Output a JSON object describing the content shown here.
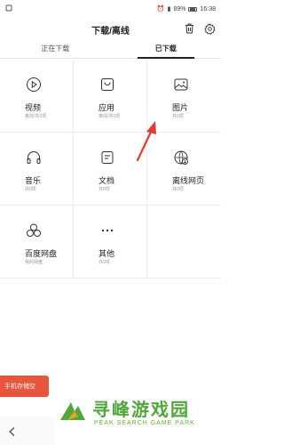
{
  "status_bar": {
    "left_icons": "notification-icon",
    "time": "16:38",
    "battery": "89%"
  },
  "header": {
    "title": "下载/离线"
  },
  "tabs": [
    {
      "label": "正在下载",
      "active": false
    },
    {
      "label": "已下载",
      "active": true
    }
  ],
  "categories": [
    {
      "title": "视频",
      "subtitle": "离线/共0项",
      "icon": "play-icon"
    },
    {
      "title": "应用",
      "subtitle": "离线/共0项",
      "icon": "bag-icon"
    },
    {
      "title": "图片",
      "subtitle": "共0项",
      "icon": "image-icon"
    },
    {
      "title": "音乐",
      "subtitle": "共0项",
      "icon": "headphones-icon"
    },
    {
      "title": "文档",
      "subtitle": "共0项",
      "icon": "document-icon"
    },
    {
      "title": "离线网页",
      "subtitle": "共0项",
      "icon": "globe-download-icon"
    },
    {
      "title": "百度网盘",
      "subtitle": "我的网盘",
      "icon": "cloud-icon"
    },
    {
      "title": "其他",
      "subtitle": "共0项",
      "icon": "more-icon"
    }
  ],
  "storage": {
    "label": "手机存储空"
  },
  "watermark": {
    "title": "寻峰游戏园",
    "subtitle": "PEAK SEARCH GAME PARK",
    "brand_color": "#4fa83a"
  },
  "colors": {
    "accent_red": "#e8553a",
    "arrow_red": "#e53935"
  }
}
